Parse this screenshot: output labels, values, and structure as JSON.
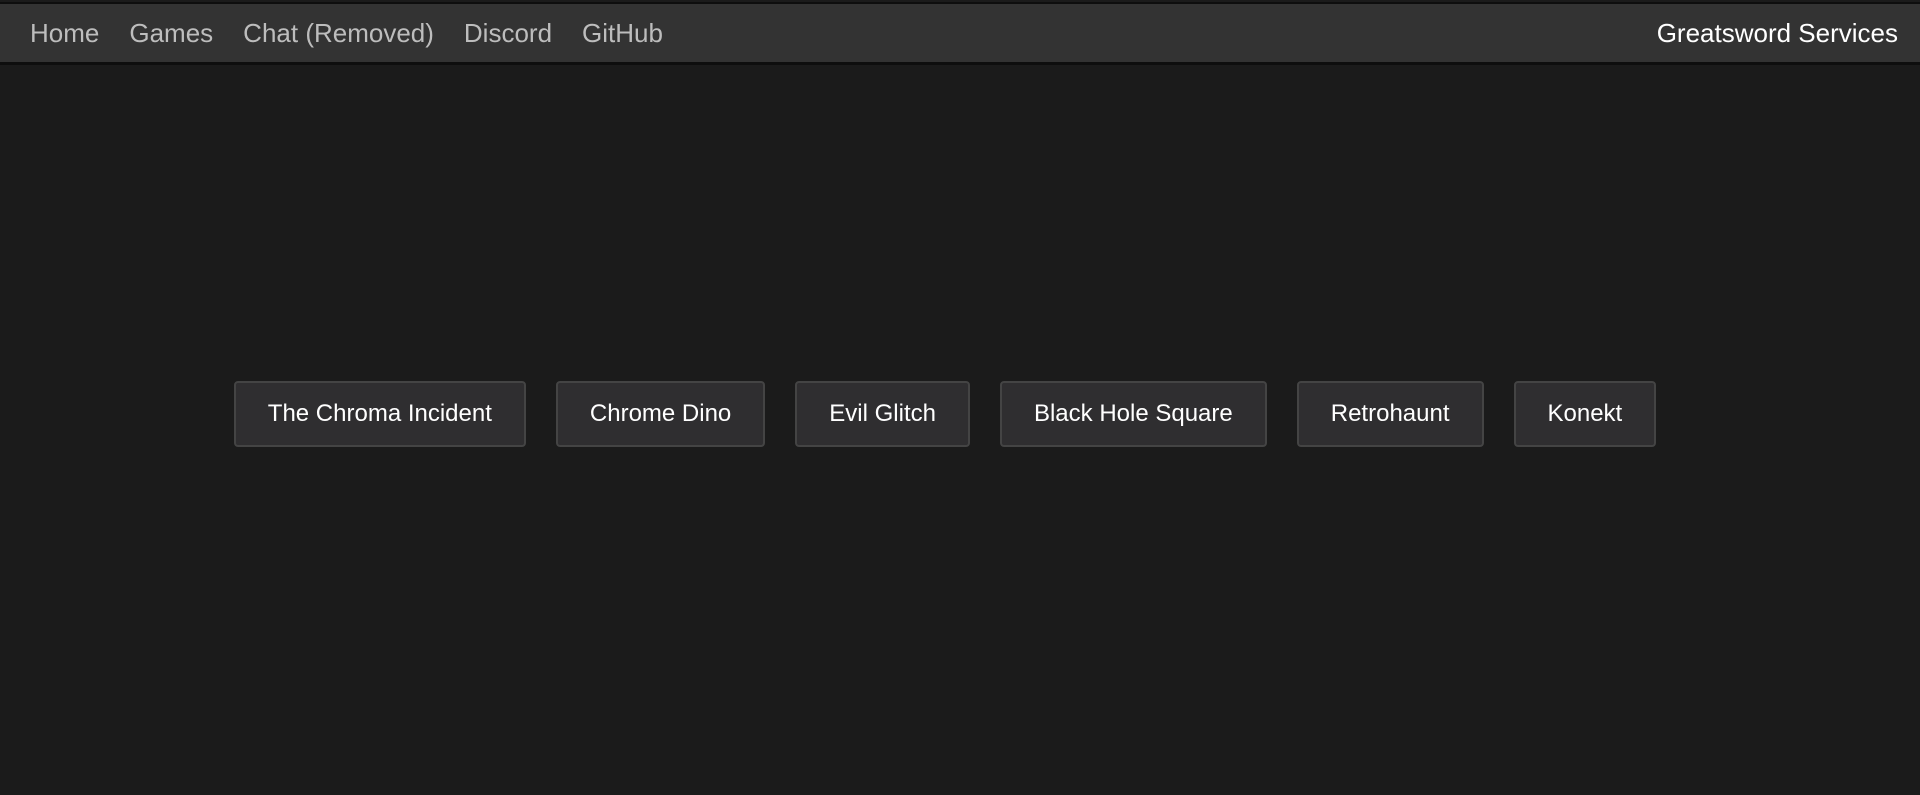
{
  "nav": {
    "items": [
      {
        "label": "Home"
      },
      {
        "label": "Games"
      },
      {
        "label": "Chat (Removed)"
      },
      {
        "label": "Discord"
      },
      {
        "label": "GitHub"
      }
    ],
    "brand": "Greatsword Services"
  },
  "games": [
    {
      "label": "The Chroma Incident"
    },
    {
      "label": "Chrome Dino"
    },
    {
      "label": "Evil Glitch"
    },
    {
      "label": "Black Hole Square"
    },
    {
      "label": "Retrohaunt"
    },
    {
      "label": "Konekt"
    }
  ],
  "colors": {
    "background": "#1b1b1b",
    "topbar": "#333333",
    "button": "#2f2e30",
    "button_border": "#444444",
    "nav_text": "#bdbdbd",
    "brand_text": "#ffffff"
  }
}
